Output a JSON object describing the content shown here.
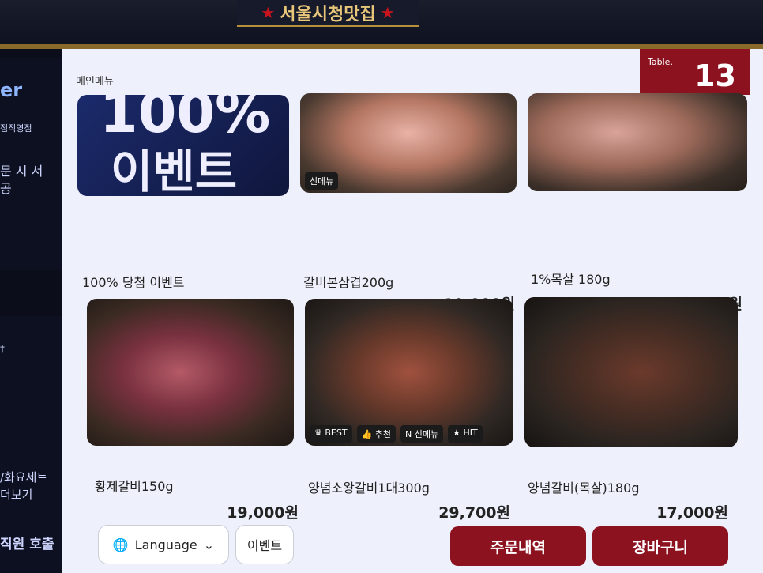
{
  "header": {
    "banner": "서울시청맛집"
  },
  "side_left": {
    "top_title": "er",
    "top_sub": "점직영점",
    "top_text1": "문 시 서",
    "top_text2": "공",
    "bottom_a": "†",
    "bottom_b1": "/화요세트",
    "bottom_b2": "더보기",
    "bottom_c": "직원 호출"
  },
  "section_title": "메인메뉴",
  "table": {
    "label": "Table.",
    "number": "13"
  },
  "menu": [
    {
      "name": "100% 당첨 이벤트",
      "price": "",
      "promo_line1": "100%",
      "promo_line2": "이벤트"
    },
    {
      "name": "갈비본삼겹200g",
      "price": "19,000원",
      "badge": "신메뉴"
    },
    {
      "name": "1%목살 180g",
      "price": "17,000원"
    },
    {
      "name": "황제갈비150g",
      "price": "19,000원"
    },
    {
      "name": "양념소왕갈비1대300g",
      "price": "29,700원",
      "badges": [
        "BEST",
        "추천",
        "신메뉴",
        "HIT"
      ]
    },
    {
      "name": "양념갈비(목살)180g",
      "price": "17,000원"
    }
  ],
  "footer": {
    "language": "Language",
    "event": "이벤트",
    "order_history": "주문내역",
    "cart": "장바구니"
  },
  "colors": {
    "accent_red": "#8c1220",
    "screen_bg": "#eef1fb"
  }
}
